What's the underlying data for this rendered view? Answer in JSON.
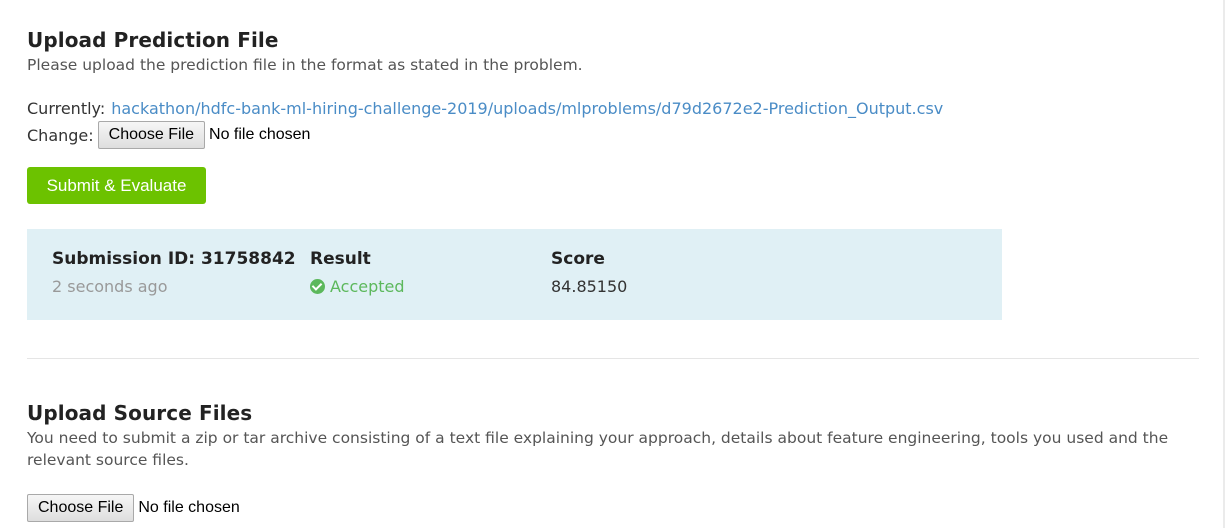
{
  "prediction_section": {
    "title": "Upload Prediction File",
    "description": "Please upload the prediction file in the format as stated in the problem.",
    "currently_label": "Currently:",
    "current_file_link": "hackathon/hdfc-bank-ml-hiring-challenge-2019/uploads/mlproblems/d79d2672e2-Prediction_Output.csv",
    "change_label": "Change:",
    "choose_file_label": "Choose File",
    "no_file_text": "No file chosen",
    "submit_label": "Submit & Evaluate"
  },
  "submission": {
    "id_label": "Submission ID: 31758842",
    "time_ago": "2 seconds ago",
    "result_label": "Result",
    "result_status": "Accepted",
    "score_label": "Score",
    "score_value": "84.85150"
  },
  "source_section": {
    "title": "Upload Source Files",
    "description": "You need to submit a zip or tar archive consisting of a text file explaining your approach, details about feature engineering, tools you used and the relevant source files.",
    "choose_file_label": "Choose File",
    "no_file_text": "No file chosen"
  },
  "colors": {
    "accent_green": "#6cc200",
    "link_blue": "#4a8cc6",
    "panel_bg": "#e0f0f5",
    "accepted_green": "#5cb85c"
  }
}
